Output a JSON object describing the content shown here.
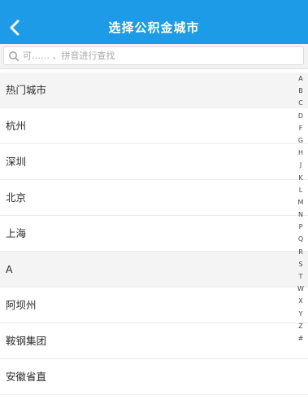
{
  "header": {
    "title": "选择公积金城市"
  },
  "search": {
    "placeholder": "可…… 、拼音进行查找"
  },
  "list": [
    {
      "label": "热门城市",
      "section": true
    },
    {
      "label": "杭州",
      "section": false
    },
    {
      "label": "深圳",
      "section": false
    },
    {
      "label": "北京",
      "section": false
    },
    {
      "label": "上海",
      "section": false
    },
    {
      "label": "A",
      "section": true
    },
    {
      "label": "阿坝州",
      "section": false
    },
    {
      "label": "鞍钢集团",
      "section": false
    },
    {
      "label": "安徽省直",
      "section": false
    }
  ],
  "index": [
    "A",
    "B",
    "C",
    "D",
    "F",
    "G",
    "H",
    "J",
    "K",
    "L",
    "M",
    "N",
    "P",
    "Q",
    "R",
    "S",
    "T",
    "W",
    "X",
    "Y",
    "Z",
    "#"
  ],
  "colors": {
    "accent": "#1e9be6",
    "section_bg": "#f4f4f4"
  },
  "icons": {
    "back": "chevron-left-icon",
    "search": "magnifier-icon"
  }
}
